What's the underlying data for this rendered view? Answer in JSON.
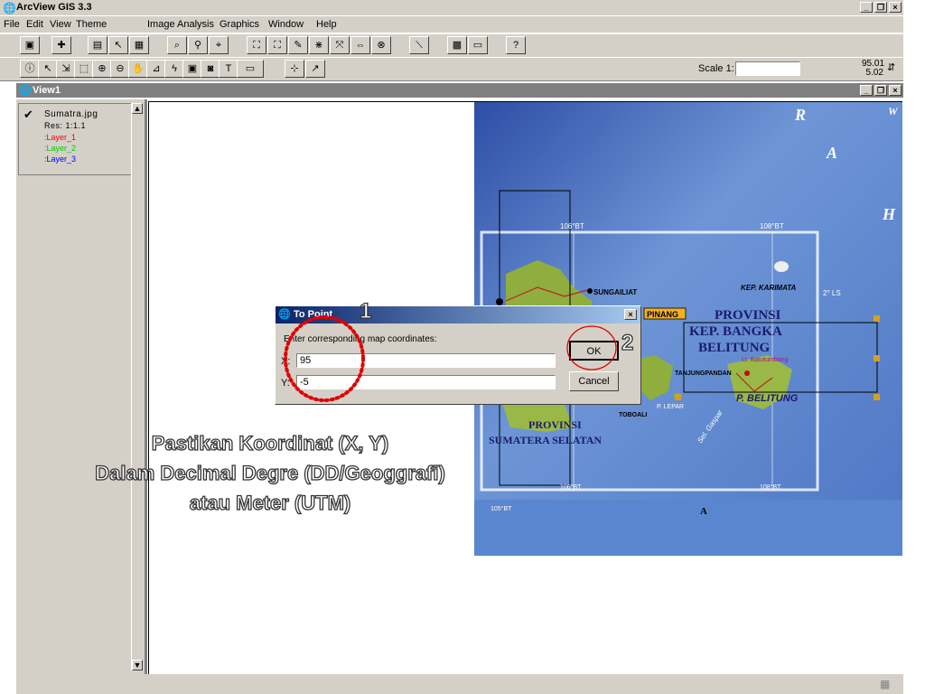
{
  "app": {
    "title": "ArcView GIS 3.3"
  },
  "menu": [
    "File",
    "Edit",
    "View",
    "Theme",
    "Image Analysis",
    "Graphics",
    "Window",
    "Help"
  ],
  "toolbar2": {
    "scale_label": "Scale 1:",
    "scale_value": "",
    "coord_x": "95.01",
    "coord_y": "5.02"
  },
  "view": {
    "title": "View1"
  },
  "toc": {
    "image_name": "Sumatra.jpg",
    "res": "Res: 1:1.1",
    "layers": [
      {
        "name": ":Layer_1",
        "color": "#ff0000"
      },
      {
        "name": ":Layer_2",
        "color": "#00cc00"
      },
      {
        "name": ":Layer_3",
        "color": "#0000ff"
      }
    ]
  },
  "map_labels": {
    "bt1": "106°BT",
    "bt2": "108°BT",
    "bt3": "106°BT",
    "bt4": "108°BT",
    "bt5": "105°BT",
    "ls": "2° LS",
    "sungailiat": "SUNGAILIAT",
    "pangkalpinang": "PINANG",
    "karimata": "KEP. KARIMATA",
    "provinsi1": "PROVINSI",
    "bangka": "KEP. BANGKA",
    "belitung": "BELITUNG",
    "batutumbang": "Lt. Batutumbang",
    "tanjungpandan": "TANJUNGPANDAN",
    "lepar": "P. LEPAR",
    "pbelitung": "P. BELITUNG",
    "toboali": "TOBOALI",
    "gaspar": "Sel. Gaspar",
    "provinsi2": "PROVINSI",
    "sumsel": "SUMATERA SELATAN",
    "a": "A",
    "ra_r": "R",
    "ra_a": "A",
    "ra_h": "H",
    "ra_w": "W"
  },
  "dialog": {
    "title": "To Point",
    "prompt": "Enter corresponding map coordinates:",
    "x_label": "X:",
    "x_value": "95",
    "y_label": "Y:",
    "y_value": "-5",
    "ok": "OK",
    "cancel": "Cancel",
    "close": "×"
  },
  "annotations": {
    "num1": "1",
    "num2": "2",
    "line1": "Pastikan Koordinat (X, Y)",
    "line2": "Dalam Decimal Degre (DD/Geoggrafi)",
    "line3": "atau Meter (UTM)"
  },
  "colors": {
    "map_sea": "#5d83c4",
    "map_land": "#8fae3e",
    "dialog_title": "#0a246a"
  }
}
